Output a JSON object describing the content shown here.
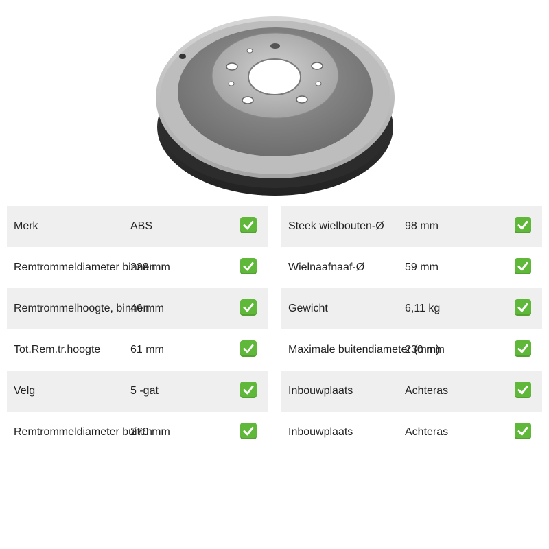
{
  "image": {
    "subject": "brake-drum",
    "icon": "brake-drum-image"
  },
  "colors": {
    "row_shade": "#efefef",
    "check_green": "#5fb83a",
    "text": "#222222"
  },
  "left_specs": [
    {
      "label": "Merk",
      "value": "ABS"
    },
    {
      "label": "Remtrommeldiameter binnen",
      "value": "228 mm"
    },
    {
      "label": "Remtrommelhoogte, binnen",
      "value": "46 mm"
    },
    {
      "label": "Tot.Rem.tr.hoogte",
      "value": "61 mm"
    },
    {
      "label": "Velg",
      "value": "5 -gat"
    },
    {
      "label": "Remtrommeldiameter buiten",
      "value": "270 mm"
    }
  ],
  "right_specs": [
    {
      "label": "Steek wielbouten-Ø",
      "value": "98 mm"
    },
    {
      "label": "Wielnaafnaaf-Ø",
      "value": "59 mm"
    },
    {
      "label": "Gewicht",
      "value": "6,11 kg"
    },
    {
      "label": "Maximale buitendiameter (mm)",
      "value": "230 mm"
    },
    {
      "label": "Inbouwplaats",
      "value": "Achteras"
    },
    {
      "label": "Inbouwplaats",
      "value": "Achteras"
    }
  ]
}
